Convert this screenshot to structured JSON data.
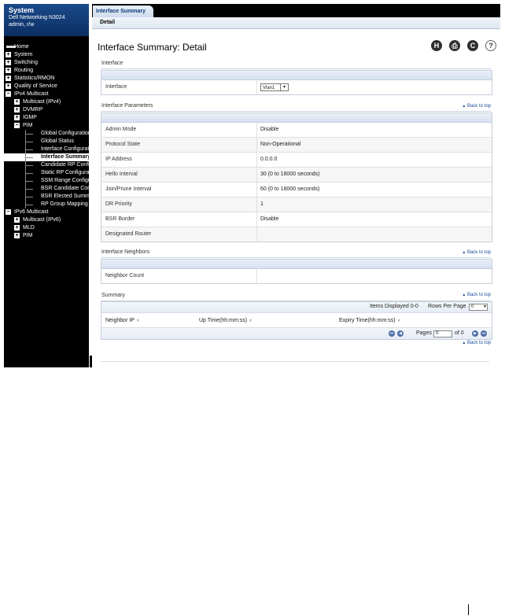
{
  "sidebar": {
    "title": "System",
    "model": "Dell Networking N3024",
    "user": "admin, r/w",
    "items": [
      {
        "label": "Home",
        "level": 0,
        "icon": "home"
      },
      {
        "label": "System",
        "level": 0,
        "icon": "plus"
      },
      {
        "label": "Switching",
        "level": 0,
        "icon": "plus"
      },
      {
        "label": "Routing",
        "level": 0,
        "icon": "plus"
      },
      {
        "label": "Statistics/RMON",
        "level": 0,
        "icon": "plus"
      },
      {
        "label": "Quality of Service",
        "level": 0,
        "icon": "plus"
      },
      {
        "label": "IPv4 Multicast",
        "level": 0,
        "icon": "minus"
      },
      {
        "label": "Multicast (IPv4)",
        "level": 1,
        "icon": "plus"
      },
      {
        "label": "DVMRP",
        "level": 1,
        "icon": "plus"
      },
      {
        "label": "IGMP",
        "level": 1,
        "icon": "plus"
      },
      {
        "label": "PIM",
        "level": 1,
        "icon": "minus"
      },
      {
        "label": "Global Configuration",
        "level": 2,
        "icon": "none"
      },
      {
        "label": "Global Status",
        "level": 2,
        "icon": "none"
      },
      {
        "label": "Interface Configuration",
        "level": 2,
        "icon": "none"
      },
      {
        "label": "Interface Summary",
        "level": 2,
        "icon": "none",
        "selected": true
      },
      {
        "label": "Candidate RP Configuration",
        "level": 2,
        "icon": "none"
      },
      {
        "label": "Static RP Configuration",
        "level": 2,
        "icon": "none"
      },
      {
        "label": "SSM Range Configuration",
        "level": 2,
        "icon": "none"
      },
      {
        "label": "BSR Candidate Configuration",
        "level": 2,
        "icon": "none"
      },
      {
        "label": "BSR Elected Summary",
        "level": 2,
        "icon": "none"
      },
      {
        "label": "RP Group Mapping",
        "level": 2,
        "icon": "none"
      },
      {
        "label": "IPv6 Multicast",
        "level": 0,
        "icon": "minus"
      },
      {
        "label": "Multicast (IPv6)",
        "level": 1,
        "icon": "plus"
      },
      {
        "label": "MLD",
        "level": 1,
        "icon": "plus"
      },
      {
        "label": "PIM",
        "level": 1,
        "icon": "plus"
      }
    ]
  },
  "tabs": {
    "active": "Interface Summary",
    "sub": "Detail"
  },
  "page": {
    "title": "Interface Summary: Detail"
  },
  "toolbar": {
    "save_icon": "H",
    "print_icon": "⎙",
    "refresh_icon": "C",
    "help_icon": "?"
  },
  "interface_section": {
    "header": "Interface",
    "label": "Interface",
    "selected": "Vlan1",
    "arrow": "▾"
  },
  "params": {
    "header": "Interface Parameters",
    "back_to_top": "Back to top",
    "rows": [
      {
        "k": "Admin Mode",
        "v": "Disable"
      },
      {
        "k": "Protocol State",
        "v": "Non-Operational"
      },
      {
        "k": "IP Address",
        "v": "0.0.0.0"
      },
      {
        "k": "Hello Interval",
        "v": "30  (0 to 18000 seconds)"
      },
      {
        "k": "Join/Prune Interval",
        "v": "60  (0 to 18000 seconds)"
      },
      {
        "k": "DR Priority",
        "v": "1"
      },
      {
        "k": "BSR Border",
        "v": "Disable"
      },
      {
        "k": "Designated Router",
        "v": ""
      }
    ]
  },
  "neighbors": {
    "header": "Interface Neighbors",
    "back_to_top": "Back to top",
    "rows": [
      {
        "k": "Neighbor Count",
        "v": ""
      }
    ]
  },
  "summary": {
    "header": "Summary",
    "back_to_top": "Back to top",
    "items_displayed": "Items Displayed 0-0",
    "rows_per_page_label": "Rows Per Page",
    "rows_per_page": "0",
    "columns": [
      "Neighbor IP",
      "Up Time(hh:mm:ss)",
      "Expiry Time(hh:mm:ss)"
    ],
    "pages_label": "Pages",
    "page": "0",
    "of_label": "of 0",
    "bottom_back_to_top": "Back to top"
  }
}
